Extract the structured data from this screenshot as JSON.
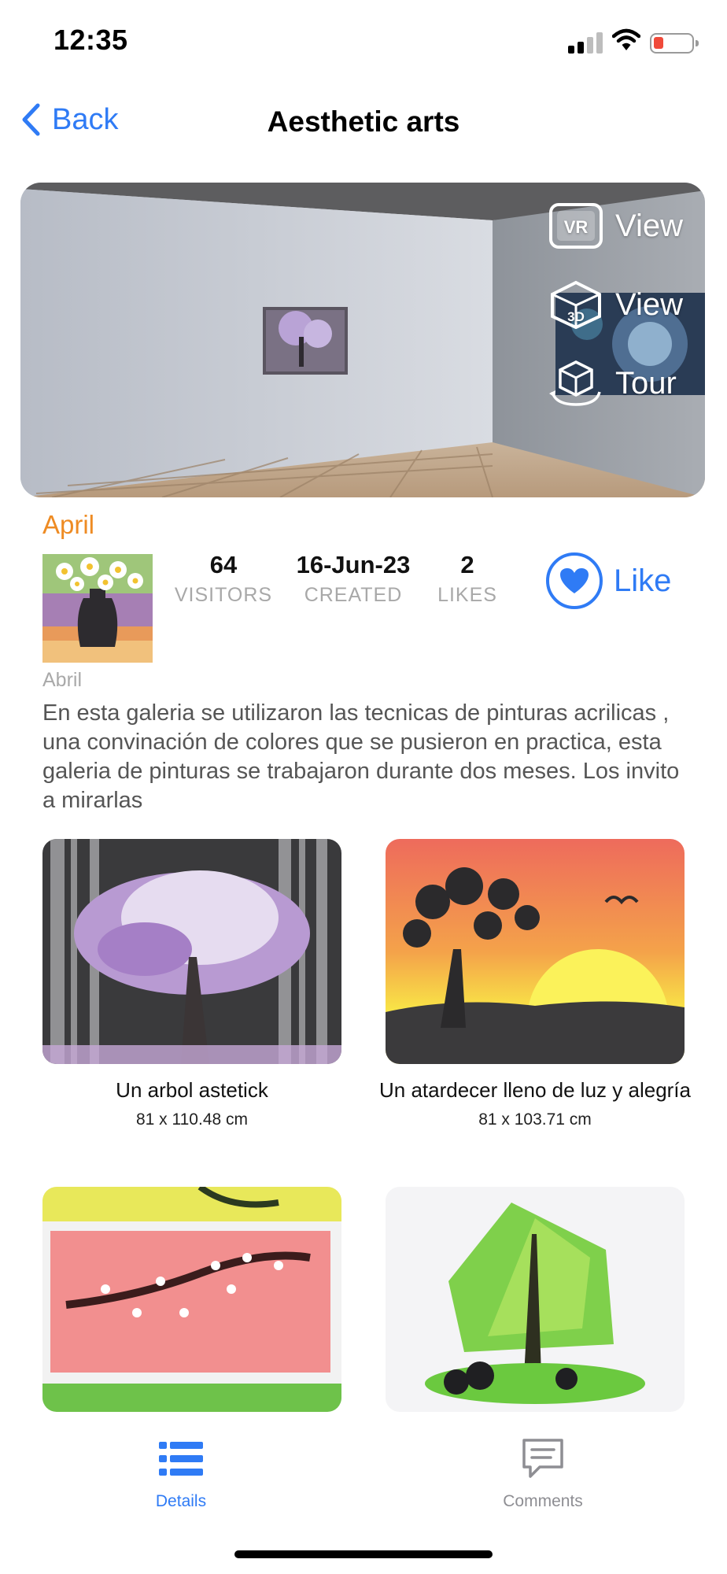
{
  "status_bar": {
    "time": "12:35",
    "icons": [
      "signal-icon",
      "wifi-icon",
      "battery-icon"
    ],
    "battery_color": "#f04a3a"
  },
  "nav": {
    "back_label": "Back",
    "title": "Aesthetic arts"
  },
  "hero": {
    "actions": [
      {
        "icon": "vr-icon",
        "label": "View"
      },
      {
        "icon": "3d-cube-icon",
        "label": "View"
      },
      {
        "icon": "3d-tour-icon",
        "label": "Tour"
      }
    ]
  },
  "author": {
    "name": "April",
    "sub_name": "Abril"
  },
  "stats": [
    {
      "value": "64",
      "label": "VISITORS"
    },
    {
      "value": "16-Jun-23",
      "label": "CREATED"
    },
    {
      "value": "2",
      "label": "LIKES"
    }
  ],
  "like_label": "Like",
  "description": "En esta galeria se utilizaron las tecnicas de pinturas acrilicas , una convinación de colores que se pusieron en practica, esta galeria de pinturas se trabajaron durante dos meses. Los invito a mirarlas",
  "artworks": [
    {
      "title": "Un arbol astetick",
      "size": "81 x 110.48 cm"
    },
    {
      "title": "Un atardecer lleno de luz y alegría",
      "size": "81 x 103.71 cm"
    },
    {
      "title": "",
      "size": ""
    },
    {
      "title": "",
      "size": ""
    }
  ],
  "tabs": [
    {
      "icon": "list-icon",
      "label": "Details",
      "active": true
    },
    {
      "icon": "comment-icon",
      "label": "Comments",
      "active": false
    }
  ],
  "colors": {
    "accent": "#2f7bf5",
    "author": "#ee8b23",
    "muted": "#a8a8a8"
  }
}
